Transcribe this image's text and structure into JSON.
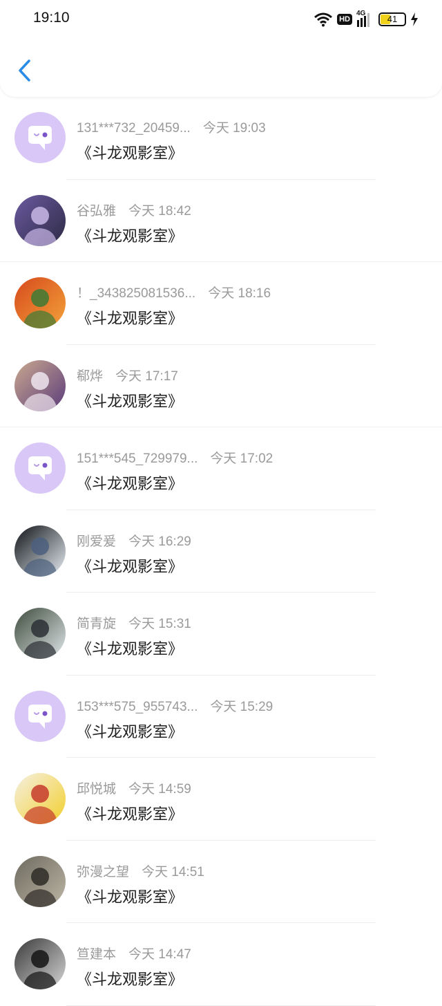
{
  "status_bar": {
    "time": "19:10",
    "network_label": "4G",
    "hd_label": "HD",
    "battery_level": "41"
  },
  "header": {
    "back_icon": "chevron-left-icon"
  },
  "colors": {
    "accent": "#2a8ce6",
    "default_avatar_bg": "#d9c7f7",
    "meta_text": "#9a9a9a",
    "message_text": "#222222"
  },
  "items": [
    {
      "name": "131***732_20459...",
      "stamp": "今天 19:03",
      "message": "《斗龙观影室》",
      "avatar": "default-chat-avatar"
    },
    {
      "name": "谷弘雅",
      "stamp": "今天 18:42",
      "message": "《斗龙观影室》",
      "avatar": "photo-avatar"
    },
    {
      "name": "！_343825081536...",
      "stamp": "今天 18:16",
      "message": "《斗龙观影室》",
      "avatar": "photo-avatar"
    },
    {
      "name": "郗烨",
      "stamp": "今天 17:17",
      "message": "《斗龙观影室》",
      "avatar": "photo-avatar"
    },
    {
      "name": "151***545_729979...",
      "stamp": "今天 17:02",
      "message": "《斗龙观影室》",
      "avatar": "default-chat-avatar"
    },
    {
      "name": "刚爱爰",
      "stamp": "今天 16:29",
      "message": "《斗龙观影室》",
      "avatar": "photo-avatar"
    },
    {
      "name": "简青旋",
      "stamp": "今天 15:31",
      "message": "《斗龙观影室》",
      "avatar": "photo-avatar"
    },
    {
      "name": "153***575_955743...",
      "stamp": "今天 15:29",
      "message": "《斗龙观影室》",
      "avatar": "default-chat-avatar"
    },
    {
      "name": "邱悦城",
      "stamp": "今天 14:59",
      "message": "《斗龙观影室》",
      "avatar": "photo-avatar"
    },
    {
      "name": "弥漫之望",
      "stamp": "今天 14:51",
      "message": "《斗龙观影室》",
      "avatar": "photo-avatar"
    },
    {
      "name": "笪建本",
      "stamp": "今天 14:47",
      "message": "《斗龙观影室》",
      "avatar": "photo-avatar"
    }
  ]
}
